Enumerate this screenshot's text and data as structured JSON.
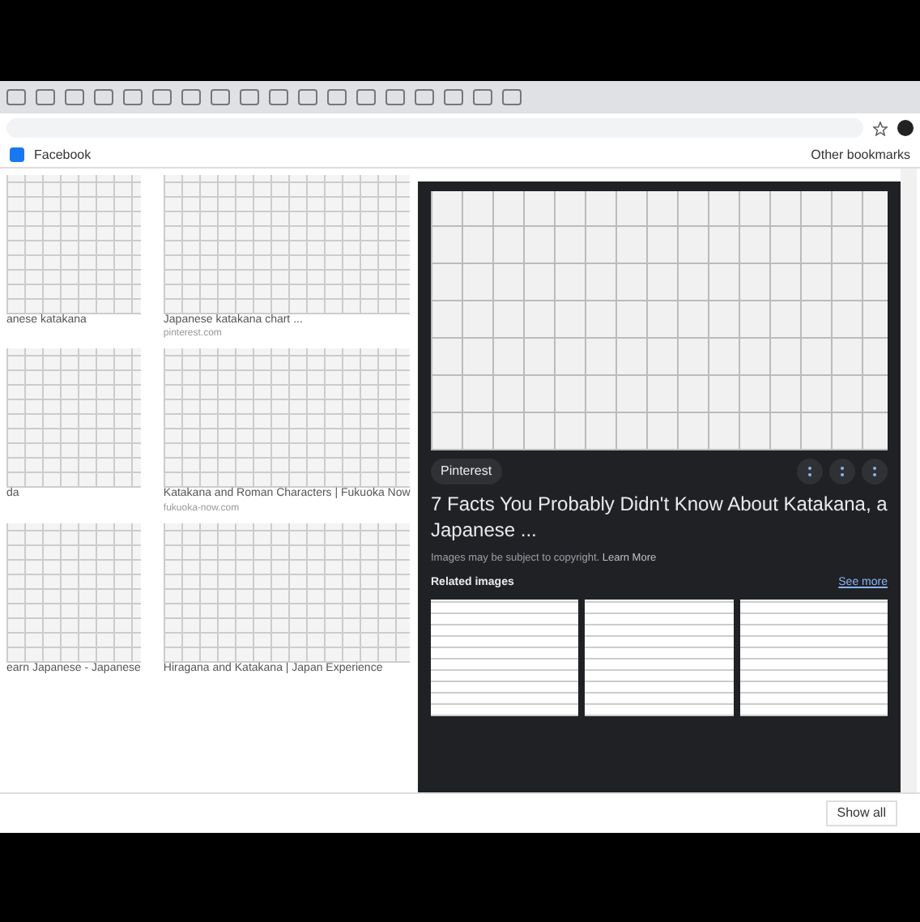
{
  "bookmarks": [
    {
      "label": "Facebook"
    }
  ],
  "other_bookmarks": "Other bookmarks",
  "results": [
    {
      "caption": "anese katakana"
    },
    {
      "caption": "Japanese katakana chart ...",
      "source": "pinterest.com"
    },
    {
      "caption": "da"
    },
    {
      "caption": "Katakana and Roman Characters | Fukuoka Now",
      "source": "fukuoka-now.com"
    },
    {
      "caption": "earn Japanese - Japanese"
    },
    {
      "caption": "Hiragana and Katakana | Japan Experience"
    }
  ],
  "panel": {
    "source": "Pinterest",
    "title": "7 Facts You Probably Didn't Know About Katakana, a Japanese ...",
    "notice": "Images may be subject to copyright.",
    "notice_link": "Learn More",
    "related_heading": "Related images",
    "see_more": "See more"
  },
  "download_bar": {
    "show_all": "Show all"
  }
}
